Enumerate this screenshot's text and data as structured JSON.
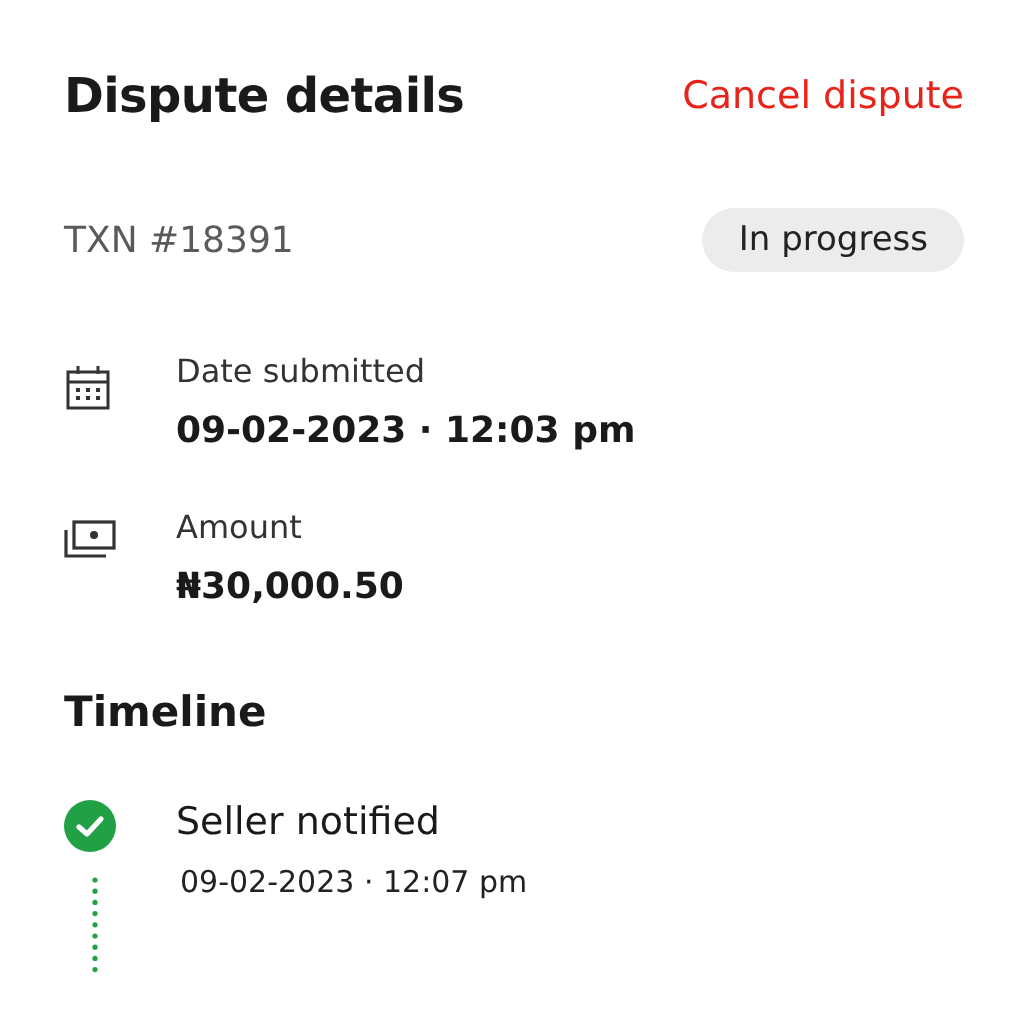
{
  "header": {
    "title": "Dispute details",
    "action": "Cancel dispute"
  },
  "transaction": {
    "id": "TXN #18391",
    "status": "In progress"
  },
  "details": [
    {
      "kind": "date",
      "label": "Date submitted",
      "value": "09-02-2023 · 12:03 pm"
    },
    {
      "kind": "amount",
      "label": "Amount",
      "value": "₦30,000.50"
    }
  ],
  "timeline": {
    "title": "Timeline",
    "events": [
      {
        "label": "Seller notified",
        "time": "09-02-2023 · 12:07 pm",
        "completed": true
      }
    ]
  }
}
